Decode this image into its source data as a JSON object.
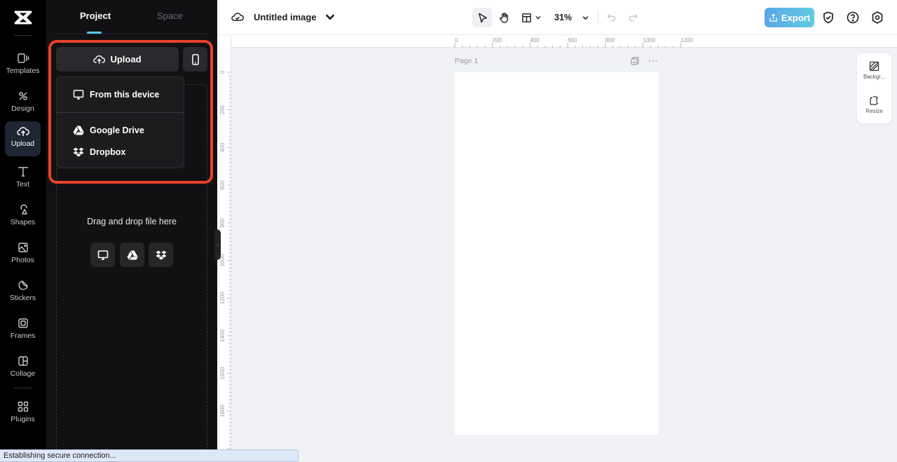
{
  "rail": {
    "items": [
      {
        "label": "Templates",
        "icon": "templates-icon"
      },
      {
        "label": "Design",
        "icon": "design-icon"
      },
      {
        "label": "Upload",
        "icon": "upload-cloud-icon",
        "active": true
      },
      {
        "label": "Text",
        "icon": "text-icon"
      },
      {
        "label": "Shapes",
        "icon": "shapes-icon"
      },
      {
        "label": "Photos",
        "icon": "photos-icon"
      },
      {
        "label": "Stickers",
        "icon": "stickers-icon"
      },
      {
        "label": "Frames",
        "icon": "frames-icon"
      },
      {
        "label": "Collage",
        "icon": "collage-icon"
      },
      {
        "label": "Plugins",
        "icon": "plugins-icon"
      }
    ]
  },
  "panel": {
    "tabs": [
      {
        "label": "Project",
        "active": true
      },
      {
        "label": "Space",
        "active": false
      }
    ],
    "upload_label": "Upload",
    "menu": {
      "items": [
        {
          "label": "From this device",
          "icon": "monitor-icon"
        },
        {
          "label": "Google Drive",
          "icon": "google-drive-icon"
        },
        {
          "label": "Dropbox",
          "icon": "dropbox-icon"
        }
      ]
    },
    "dropzone_text": "Drag and drop file here"
  },
  "header": {
    "title": "Untitled image",
    "zoom": "31%",
    "export_label": "Export",
    "accent": "#5aa5e8"
  },
  "rulers": {
    "horizontal": [
      "0",
      "200",
      "400",
      "600",
      "800",
      "1000",
      "1200"
    ],
    "vertical": [
      "0",
      "200",
      "400",
      "600",
      "800",
      "1000",
      "1200",
      "1400",
      "1600",
      "1800"
    ]
  },
  "canvas": {
    "page_label": "Page 1"
  },
  "side_tools": [
    {
      "label": "Backgr...",
      "icon": "background-icon"
    },
    {
      "label": "Resize",
      "icon": "resize-icon"
    }
  ],
  "status_text": "Establishing secure connection..."
}
